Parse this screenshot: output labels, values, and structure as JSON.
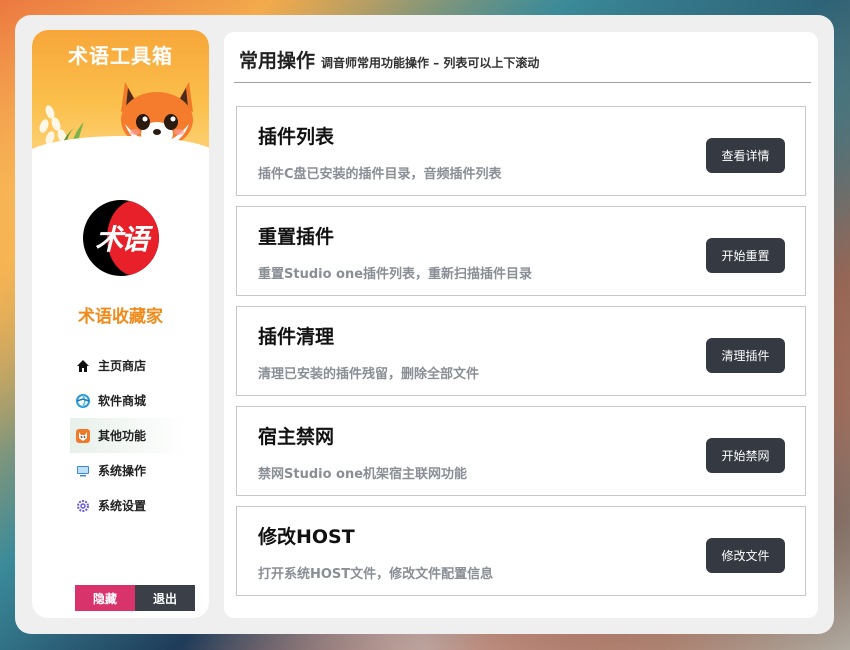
{
  "sidebar": {
    "banner_title": "术语工具箱",
    "logo_text": "术语",
    "brand_name": "术语收藏家",
    "items": [
      {
        "label": "主页商店",
        "icon": "home-icon"
      },
      {
        "label": "软件商城",
        "icon": "aperture-icon"
      },
      {
        "label": "其他功能",
        "icon": "fox-icon"
      },
      {
        "label": "系统操作",
        "icon": "monitor-icon"
      },
      {
        "label": "系统设置",
        "icon": "gear-icon"
      }
    ],
    "hide_label": "隐藏",
    "exit_label": "退出"
  },
  "main": {
    "title": "常用操作",
    "subtitle": "调音师常用功能操作 – 列表可以上下滚动",
    "cards": [
      {
        "title": "插件列表",
        "desc": "插件C盘已安装的插件目录，音频插件列表",
        "button": "查看详情"
      },
      {
        "title": "重置插件",
        "desc": "重置Studio one插件列表，重新扫描插件目录",
        "button": "开始重置"
      },
      {
        "title": "插件清理",
        "desc": "清理已安装的插件残留，删除全部文件",
        "button": "清理插件"
      },
      {
        "title": "宿主禁网",
        "desc": "禁网Studio one机架宿主联网功能",
        "button": "开始禁网"
      },
      {
        "title": "修改HOST",
        "desc": "打开系统HOST文件，修改文件配置信息",
        "button": "修改文件"
      }
    ]
  },
  "colors": {
    "accent_orange": "#f08a1a",
    "hide_button": "#d8336a",
    "dark_button": "#353a42"
  }
}
